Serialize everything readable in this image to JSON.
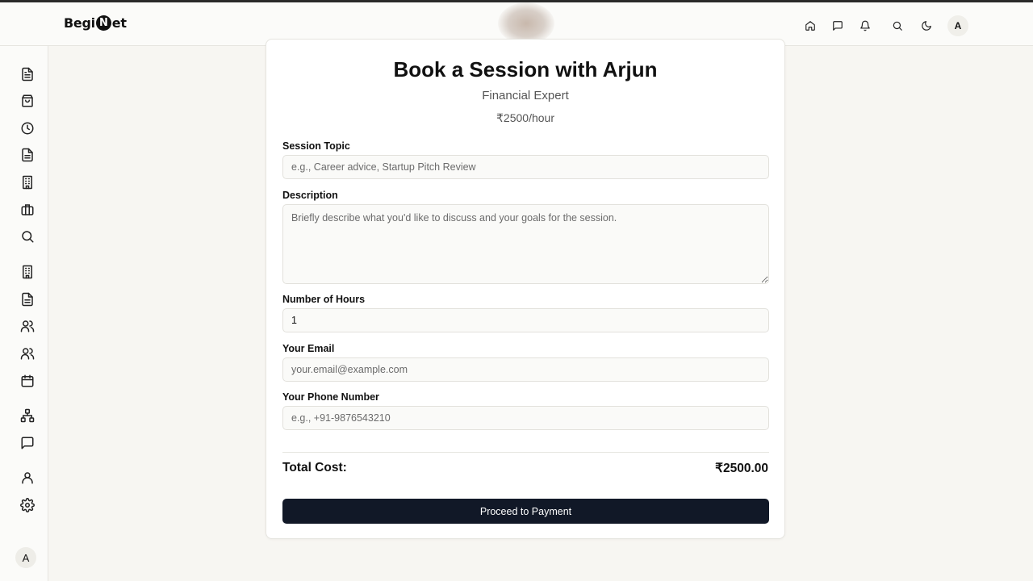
{
  "app": {
    "logo_prefix": "Begi",
    "logo_n": "N",
    "logo_suffix": "et",
    "user_initial": "A"
  },
  "header": {
    "icons": [
      "home-icon",
      "message-icon",
      "bell-icon",
      "search-icon",
      "moon-icon"
    ],
    "user_initial": "A"
  },
  "sidebar": {
    "icons": [
      "document-icon",
      "bag-icon",
      "clock-icon",
      "file-text-icon",
      "building-icon",
      "briefcase-icon",
      "search-icon",
      "building-icon",
      "file-text-icon",
      "users-icon",
      "users-icon",
      "calendar-icon",
      "network-icon",
      "message-icon",
      "user-icon",
      "gear-icon"
    ],
    "user_initial": "A"
  },
  "form": {
    "title": "Book a Session with Arjun",
    "subtitle": "Financial Expert",
    "rate": "₹2500/hour",
    "topic_label": "Session Topic",
    "topic_placeholder": "e.g., Career advice, Startup Pitch Review",
    "description_label": "Description",
    "description_placeholder": "Briefly describe what you'd like to discuss and your goals for the session.",
    "hours_label": "Number of Hours",
    "hours_value": "1",
    "email_label": "Your Email",
    "email_placeholder": "your.email@example.com",
    "phone_label": "Your Phone Number",
    "phone_placeholder": "e.g., +91-9876543210",
    "total_label": "Total Cost:",
    "total_value": "₹2500.00",
    "submit_label": "Proceed to Payment"
  },
  "colors": {
    "button_bg": "#111827",
    "page_bg": "#f7f6f2"
  }
}
